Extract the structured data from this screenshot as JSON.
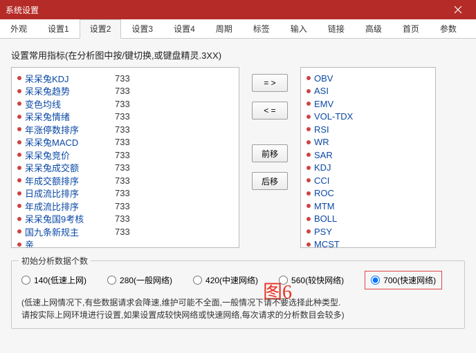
{
  "window": {
    "title": "系统设置"
  },
  "tabs": [
    "外观",
    "设置1",
    "设置2",
    "设置3",
    "设置4",
    "周期",
    "标签",
    "输入",
    "链接",
    "高级",
    "首页",
    "参数"
  ],
  "activeTab": 2,
  "sectionLabel": "设置常用指标(在分析图中按/键切换,或键盘精灵.3XX)",
  "leftList": [
    {
      "name": "呆呆兔KDJ",
      "num": "733"
    },
    {
      "name": "呆呆兔趋势",
      "num": "733"
    },
    {
      "name": "变色均线",
      "num": "733"
    },
    {
      "name": "呆呆兔情绪",
      "num": "733"
    },
    {
      "name": "年涨停数排序",
      "num": "733"
    },
    {
      "name": "呆呆兔MACD",
      "num": "733"
    },
    {
      "name": "呆呆兔竞价",
      "num": "733"
    },
    {
      "name": "呆呆兔成交额",
      "num": "733"
    },
    {
      "name": "年成交额排序",
      "num": "733"
    },
    {
      "name": "日成流比排序",
      "num": "733"
    },
    {
      "name": "年成流比排序",
      "num": "733"
    },
    {
      "name": "呆呆兔国9考核",
      "num": "733"
    },
    {
      "name": "国九条新规主",
      "num": "733"
    },
    {
      "name": "亲",
      "num": ""
    }
  ],
  "rightList": [
    "OBV",
    "ASI",
    "EMV",
    "VOL-TDX",
    "RSI",
    "WR",
    "SAR",
    "KDJ",
    "CCI",
    "ROC",
    "MTM",
    "BOLL",
    "PSY",
    "MCST"
  ],
  "buttons": {
    "add": "= >",
    "remove": "< =",
    "moveUp": "前移",
    "moveDown": "后移"
  },
  "annotation": "图6",
  "group": {
    "title": "初始分析数据个数",
    "options": [
      "140(低速上网)",
      "280(一般网络)",
      "420(中速网络)",
      "560(较快网络)",
      "700(快速网络)"
    ],
    "selected": 4,
    "help1": "(低速上网情况下,有些数据请求会降速,维护可能不全面,一般情况下请不要选择此种类型.",
    "help2": "请按实际上网环境进行设置,如果设置成较快网络或快速网络,每次请求的分析数目会较多)"
  }
}
